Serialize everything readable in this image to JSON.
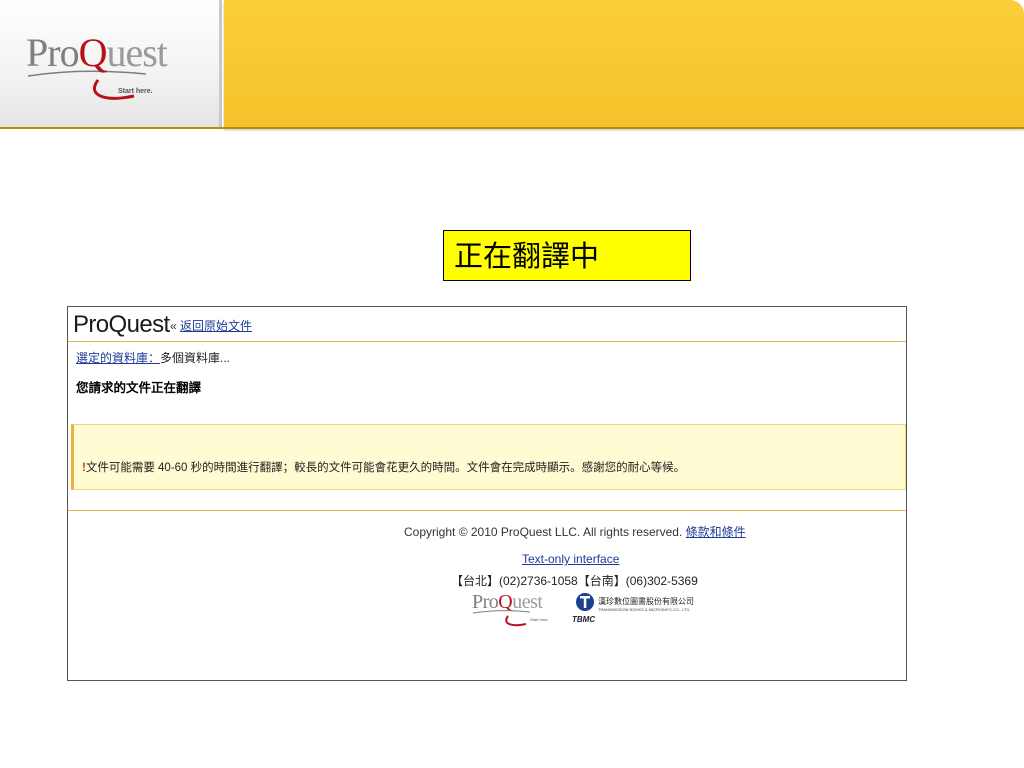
{
  "header": {
    "logo": {
      "pro": "Pro",
      "q": "Q",
      "uest": "uest",
      "tagline": "Start here."
    }
  },
  "translate_label": "正在翻譯中",
  "frame": {
    "logo_text": "ProQuest",
    "back_prefix": "«",
    "back_link": "返回原始文件",
    "db_label": "選定的資料庫：",
    "db_value": "多個資料庫...",
    "request_title": "您請求的文件正在翻譯",
    "notice_bang": "!",
    "notice_text": "文件可能需要 40-60 秒的時間進行翻譯；較長的文件可能會花更久的時間。文件會在完成時顯示。感謝您的耐心等候。",
    "copyright": "Copyright © 2010 ProQuest LLC. All rights reserved.",
    "terms_link": "條款和條件",
    "text_only_link": "Text-only interface",
    "phone": "【台北】(02)2736-1058【台南】(06)302-5369",
    "footer_logo": {
      "pro": "Pro",
      "q": "Q",
      "uest": "uest",
      "tagline": "Start here."
    },
    "tbmc": {
      "name": "漢珍數位圖書股份有限公司",
      "name_en": "TRANSMISSION BOOKS & MICROINFO CO., LTD.",
      "abbr": "TBMC"
    }
  },
  "colors": {
    "accent_yellow": "#f6c22a",
    "label_yellow": "#ffff00",
    "link_blue": "#1f3b9a",
    "logo_red": "#b8111c"
  }
}
